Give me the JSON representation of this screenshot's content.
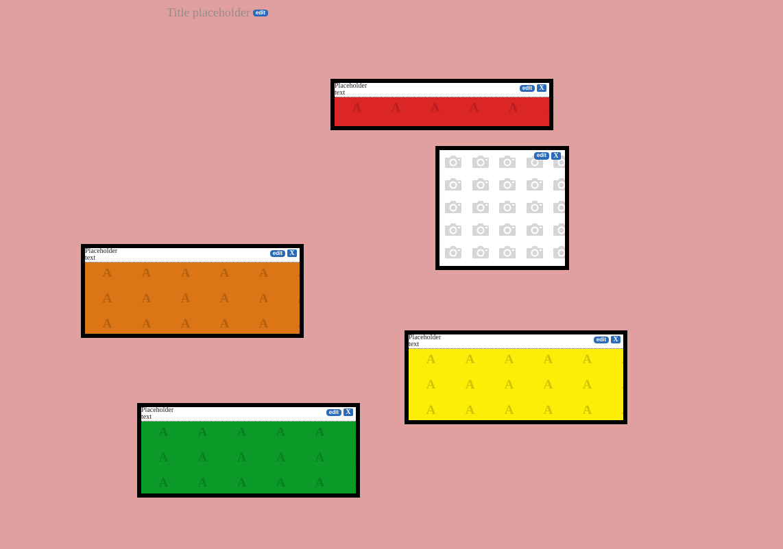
{
  "title": {
    "text": "Title placeholder",
    "edit_label": "edit"
  },
  "widgets": [
    {
      "id": "red",
      "label": "Placeholder text",
      "edit_label": "edit",
      "close_label": "X",
      "color": "#dc2626",
      "letter": "A"
    },
    {
      "id": "orange",
      "label": "Placeholder text",
      "edit_label": "edit",
      "close_label": "X",
      "color": "#db7515",
      "letter": "A"
    },
    {
      "id": "yellow",
      "label": "Placeholder text",
      "edit_label": "edit",
      "close_label": "X",
      "color": "#fdee07",
      "letter": "A"
    },
    {
      "id": "green",
      "label": "Placeholder text",
      "edit_label": "edit",
      "close_label": "X",
      "color": "#0b9a28",
      "letter": "A"
    }
  ],
  "photo_widget": {
    "edit_label": "edit",
    "close_label": "X",
    "icon": "camera-icon"
  }
}
